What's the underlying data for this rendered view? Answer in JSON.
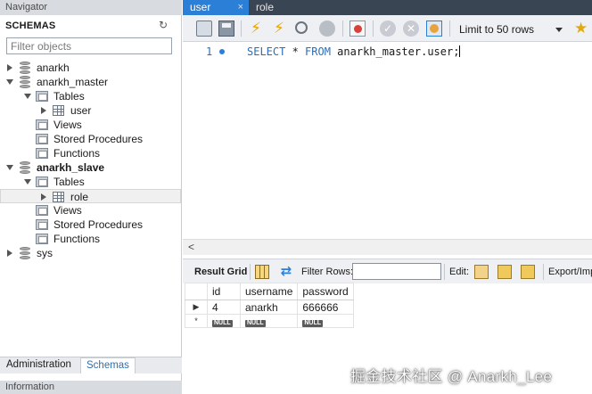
{
  "navigator": {
    "header": "Navigator",
    "schemas_title": "SCHEMAS",
    "filter_placeholder": "Filter objects",
    "tree": {
      "anarkh": "anarkh",
      "anarkh_master": "anarkh_master",
      "master_tables": "Tables",
      "master_user": "user",
      "master_views": "Views",
      "master_procs": "Stored Procedures",
      "master_funcs": "Functions",
      "anarkh_slave": "anarkh_slave",
      "slave_tables": "Tables",
      "slave_role": "role",
      "slave_views": "Views",
      "slave_procs": "Stored Procedures",
      "slave_funcs": "Functions",
      "sys": "sys"
    },
    "tabs": {
      "administration": "Administration",
      "schemas": "Schemas"
    },
    "info_header": "Information"
  },
  "query_tabs": {
    "user": "user",
    "user_close": "×",
    "role": "role"
  },
  "toolbar": {
    "limit_label": "Limit to 50 rows"
  },
  "editor": {
    "line_number": "1",
    "sql_select": "SELECT",
    "sql_star": " * ",
    "sql_from": "FROM",
    "sql_target": " anarkh_master.user",
    "sql_semicolon": ";"
  },
  "result_toolbar": {
    "result_grid_label": "Result Grid",
    "filter_rows_label": "Filter Rows:",
    "edit_label": "Edit:",
    "export_label": "Export/Imp"
  },
  "grid": {
    "columns": [
      "id",
      "username",
      "password"
    ],
    "rows": [
      {
        "id": "4",
        "username": "anarkh",
        "password": "666666"
      }
    ],
    "new_row_marker": "*",
    "null_label": "NULL"
  },
  "watermark": "掘金技术社区 @ Anarkh_Lee",
  "colors": {
    "active_tab": "#2c7fd6",
    "tabbar_bg": "#3a4554",
    "keyword": "#2c6fb6"
  }
}
